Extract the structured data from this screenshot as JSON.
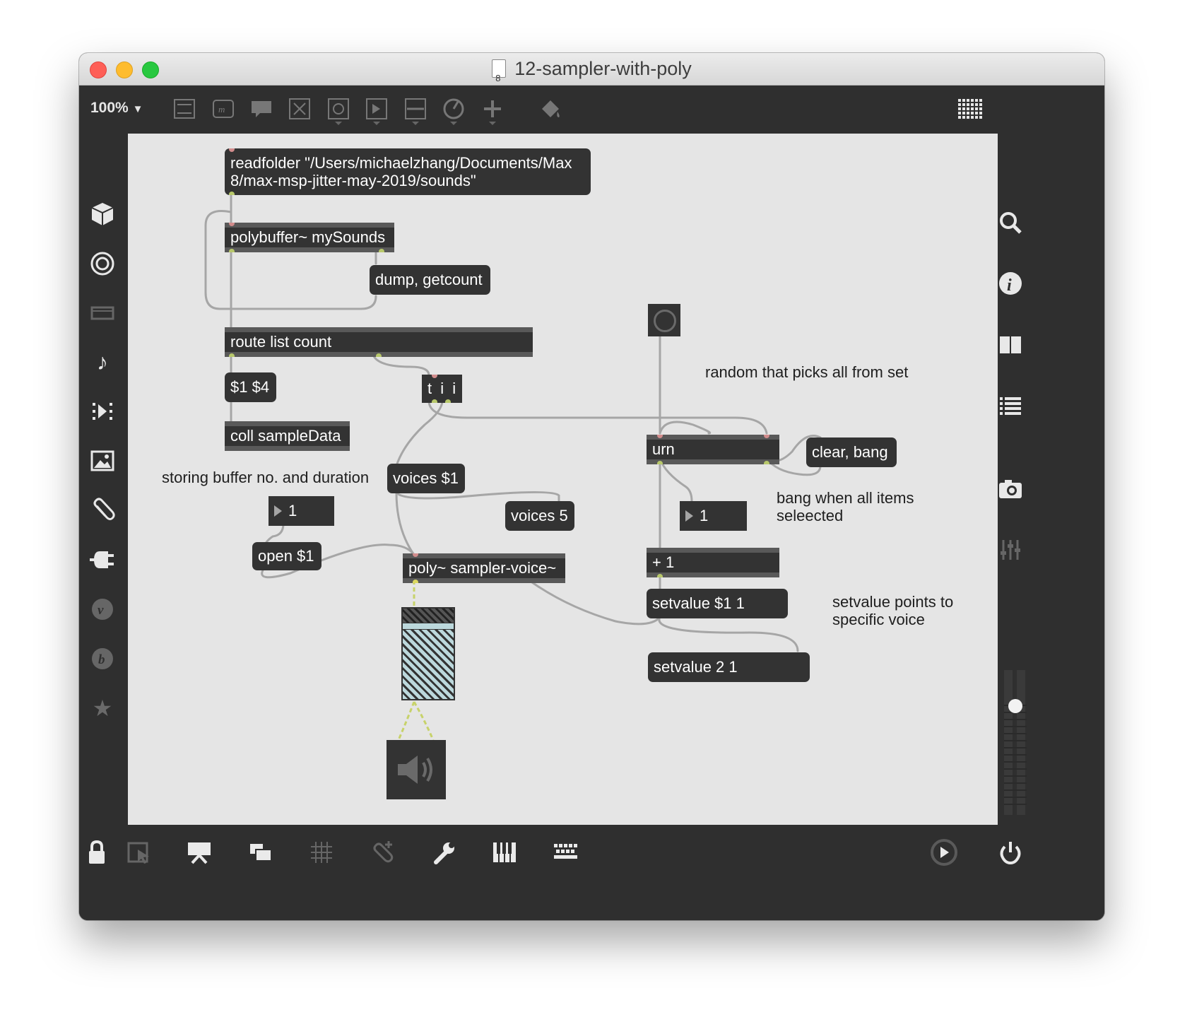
{
  "window": {
    "title": "12-sampler-with-poly"
  },
  "toolbar": {
    "zoom": "100%",
    "zoom_caret": "▼",
    "icons": [
      "new-object-icon",
      "message-icon",
      "comment-icon",
      "toggle-icon",
      "bang-icon",
      "number-icon",
      "slider-icon",
      "dial-icon",
      "add-icon",
      "paint-bucket-icon",
      "grid-icon"
    ]
  },
  "left_sidebar": [
    "cube-icon",
    "target-icon",
    "film-icon",
    "music-note-icon",
    "sequence-icon",
    "image-icon",
    "paperclip-icon",
    "plug-icon",
    "v-icon",
    "b-icon",
    "star-icon"
  ],
  "right_sidebar": [
    "search-icon",
    "info-icon",
    "columns-icon",
    "list-icon",
    "camera-icon",
    "mixer-icon"
  ],
  "bottom_bar": [
    "lock-icon",
    "presentation-select-icon",
    "presentation-icon",
    "windows-icon",
    "grid-icon",
    "connect-icon",
    "wrench-icon",
    "piano-icon",
    "keyboard-icon",
    "play-icon",
    "power-icon"
  ],
  "patch": {
    "readfolder_msg": "readfolder \"/Users/michaelzhang/Documents/Max 8/max-msp-jitter-may-2019/sounds\"",
    "polybuffer": "polybuffer~ mySounds",
    "dump_msg": "dump, getcount",
    "route": "route list count",
    "args_msg": "$1 $4",
    "coll": "coll sampleData",
    "storing_comment": "storing buffer no. and duration",
    "number_open": "1",
    "open_msg": "open $1",
    "trigger": "t i i",
    "voices_msg": "voices $1",
    "voices5_msg": "voices 5",
    "poly": "poly~ sampler-voice~",
    "random_comment": "random that picks all from set",
    "urn": "urn",
    "clear_msg": "clear, bang",
    "bang_comment": "bang when all items seleected",
    "number_urn": "1",
    "plus_one": "+ 1",
    "setvalue_msg": "setvalue $1 1",
    "setvalue_comment": "setvalue points to specific voice",
    "setvalue21_msg": "setvalue 2 1"
  },
  "colors": {
    "object_bg": "#333333",
    "canvas_bg": "#e5e5e5",
    "patchcord": "#a6a6a6",
    "signal_cord": "#c7d26a",
    "inlet": "#d28c8c",
    "outlet": "#b8c86b"
  }
}
